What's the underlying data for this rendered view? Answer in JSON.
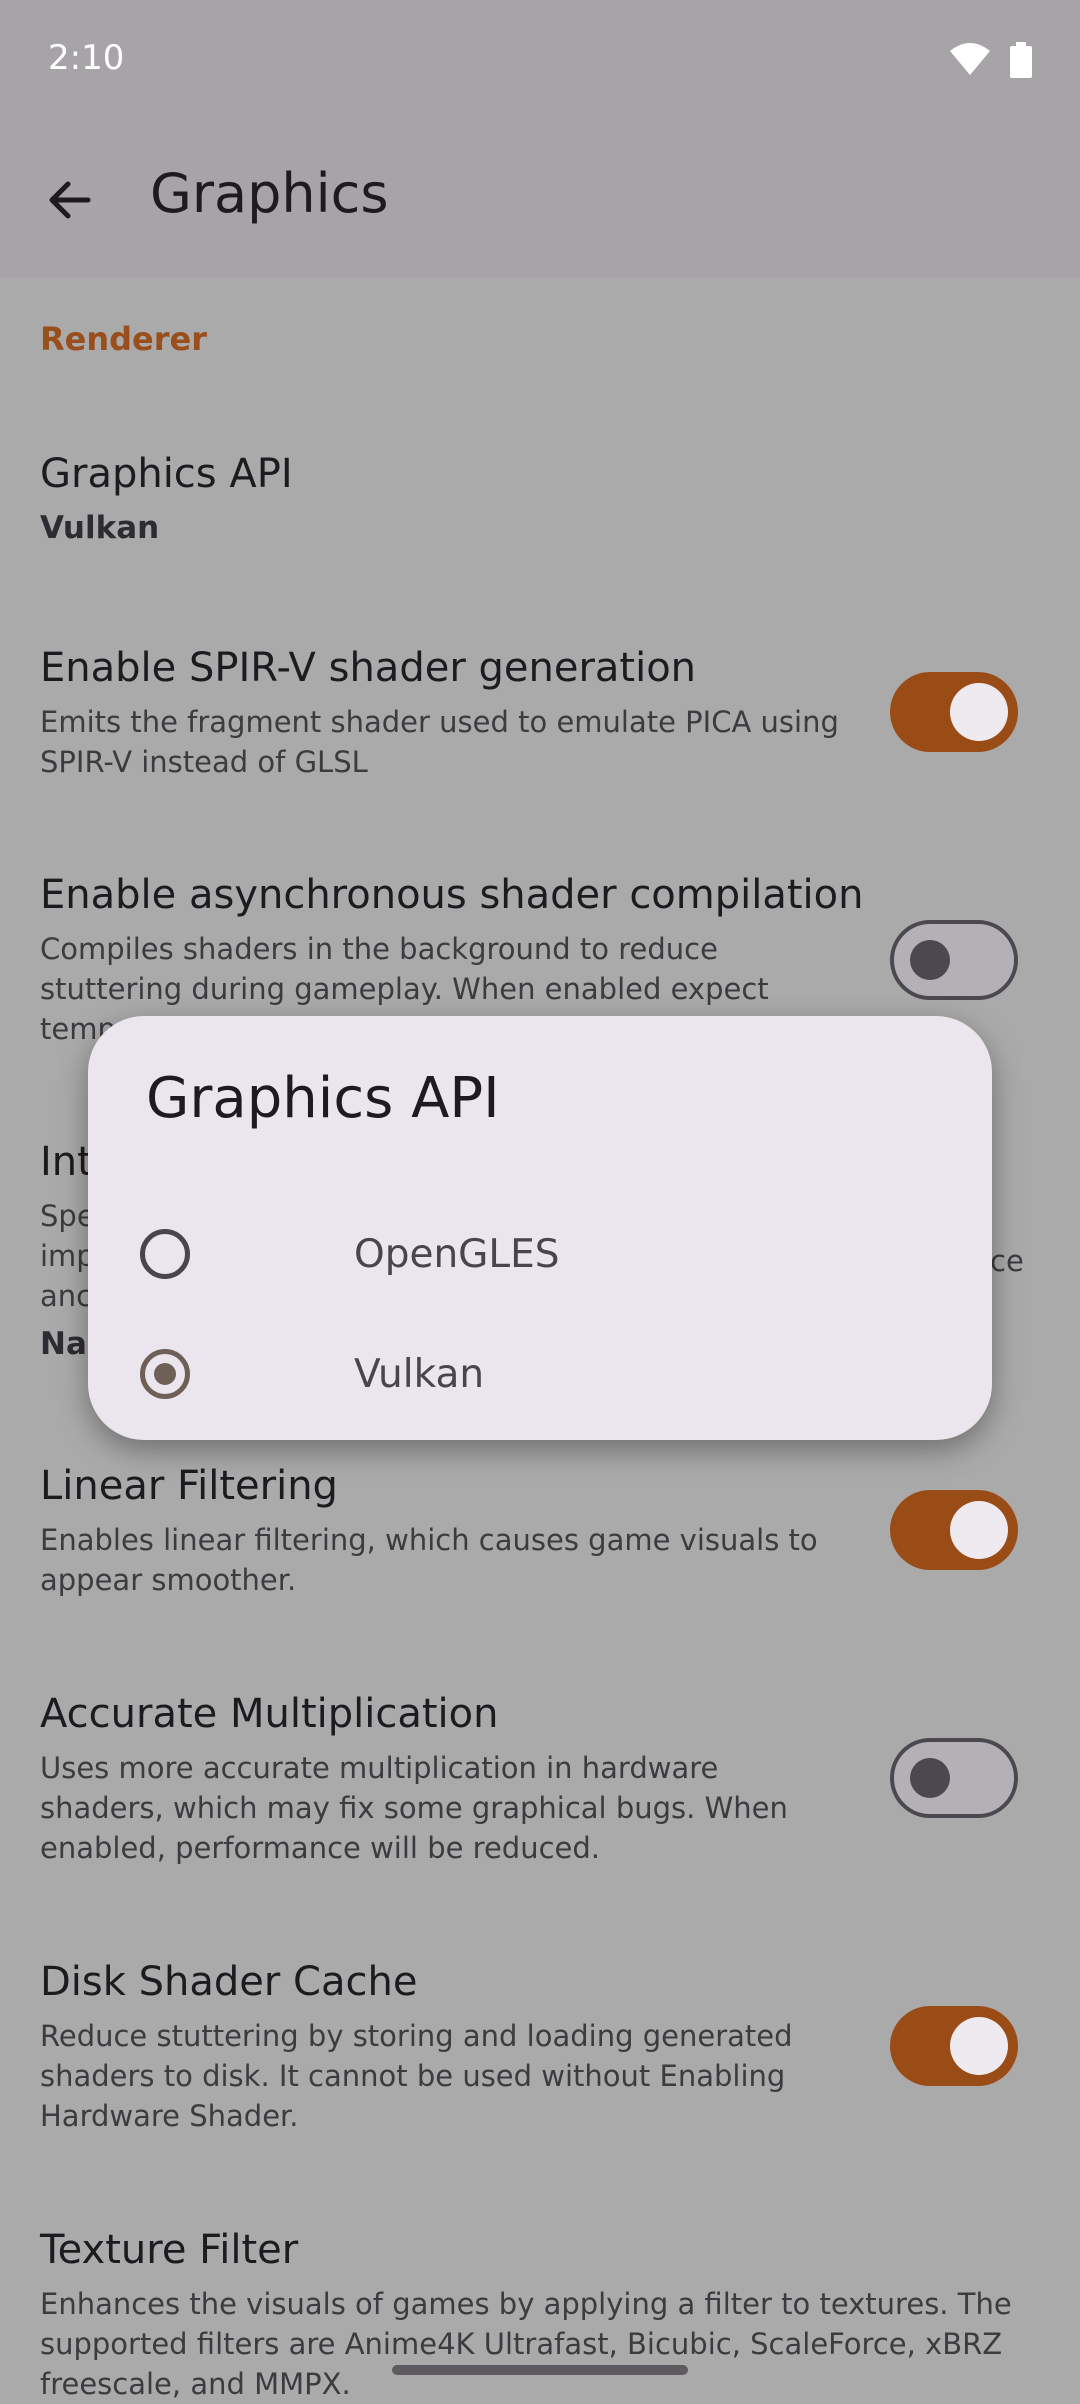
{
  "status_bar": {
    "time": "2:10",
    "icons": [
      "wifi-icon",
      "battery-icon"
    ]
  },
  "app_bar": {
    "title": "Graphics",
    "back_icon": "arrow-back-icon"
  },
  "section": {
    "header": "Renderer"
  },
  "settings": [
    {
      "title": "Graphics API",
      "value": "Vulkan"
    },
    {
      "title": "Enable SPIR-V shader generation",
      "desc": "Emits the fragment shader used to emulate PICA using SPIR-V instead of GLSL",
      "enabled": true
    },
    {
      "title": "Enable asynchronous shader compilation",
      "desc": "Compiles shaders in the background to reduce stuttering during gameplay. When enabled expect temp",
      "enabled": false
    },
    {
      "title": "Int",
      "desc_lines": [
        "Spe",
        "imp",
        "anc"
      ],
      "desc_right": "ce",
      "value": "Na"
    },
    {
      "title": "Linear Filtering",
      "desc": "Enables linear filtering, which causes game visuals to appear smoother.",
      "enabled": true
    },
    {
      "title": "Accurate Multiplication",
      "desc": "Uses more accurate multiplication in hardware shaders, which may fix some graphical bugs. When enabled, performance will be reduced.",
      "enabled": false
    },
    {
      "title": "Disk Shader Cache",
      "desc": "Reduce stuttering by storing and loading generated shaders to disk. It cannot be used without Enabling Hardware Shader.",
      "enabled": true
    },
    {
      "title": "Texture Filter",
      "desc": "Enhances the visuals of games by applying a filter to textures. The supported filters are Anime4K Ultrafast, Bicubic, ScaleForce, xBRZ freescale, and MMPX."
    }
  ],
  "dialog": {
    "title": "Graphics API",
    "options": [
      {
        "label": "OpenGLES",
        "selected": false
      },
      {
        "label": "Vulkan",
        "selected": true
      }
    ]
  },
  "colors": {
    "accent": "#9a4c16",
    "scrim": "#aaaaaa",
    "dialog_bg": "#ebe5ee"
  }
}
